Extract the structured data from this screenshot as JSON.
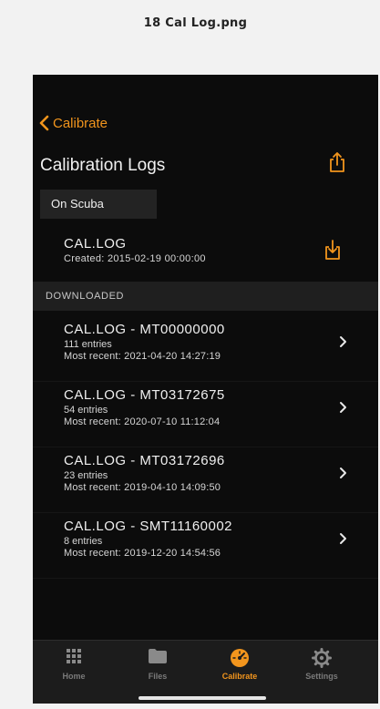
{
  "image_caption": "18 Cal Log.png",
  "nav": {
    "back_label": "Calibrate"
  },
  "page": {
    "title": "Calibration Logs"
  },
  "on_scuba": {
    "tab_label": "On Scuba",
    "file": {
      "name": "CAL.LOG",
      "created": "Created: 2015-02-19 00:00:00"
    }
  },
  "downloaded": {
    "header": "DOWNLOADED",
    "logs": [
      {
        "name": "CAL.LOG - MT00000000",
        "entries": "111 entries",
        "recent": "Most recent: 2021-04-20 14:27:19"
      },
      {
        "name": "CAL.LOG - MT03172675",
        "entries": "54 entries",
        "recent": "Most recent: 2020-07-10 11:12:04"
      },
      {
        "name": "CAL.LOG - MT03172696",
        "entries": "23 entries",
        "recent": "Most recent: 2019-04-10 14:09:50"
      },
      {
        "name": "CAL.LOG - SMT11160002",
        "entries": "8 entries",
        "recent": "Most recent: 2019-12-20 14:54:56"
      }
    ]
  },
  "tabs": [
    {
      "label": "Home",
      "icon": "grid-icon"
    },
    {
      "label": "Files",
      "icon": "folder-icon"
    },
    {
      "label": "Calibrate",
      "icon": "gauge-icon",
      "active": true
    },
    {
      "label": "Settings",
      "icon": "gear-icon"
    }
  ],
  "colors": {
    "accent": "#f2951d",
    "background": "#0c0c0c",
    "section": "#1f1f1f"
  }
}
